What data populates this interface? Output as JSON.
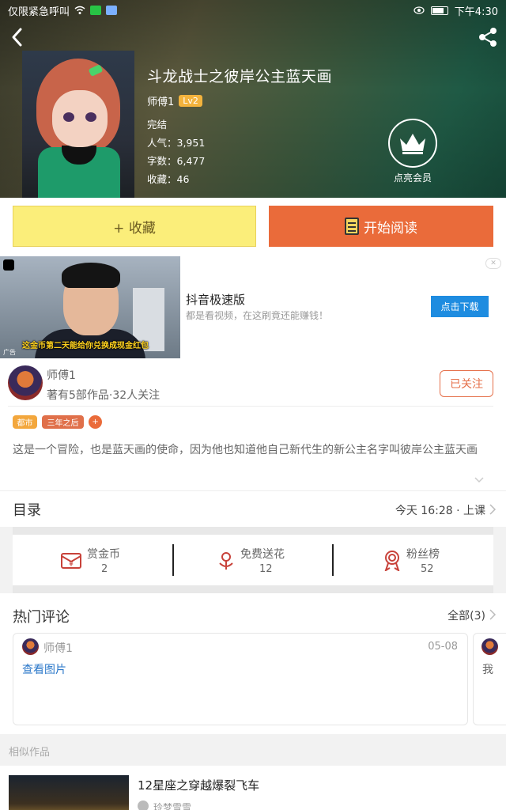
{
  "status_bar": {
    "left_text": "仅限紧急呼叫",
    "time": "下午4:30"
  },
  "book": {
    "title": "斗龙战士之彼岸公主蓝天画",
    "author": "师傅1",
    "level": "Lv2",
    "status": "完结",
    "popularity": "人气：3,951",
    "word_count": "字数：6,477",
    "favorites": "收藏：46"
  },
  "member": {
    "label": "点亮会员"
  },
  "actions": {
    "favorite_label": "+ 收藏",
    "read_label": "开始阅读"
  },
  "ad": {
    "video_caption": "这金币第二天能给你兑换成现金红包",
    "ad_tag": "广告",
    "title": "抖音极速版",
    "description": "都是看视频，在这刷竟还能赚钱！",
    "button": "点击下载"
  },
  "author_card": {
    "name": "师傅1",
    "summary": "著有5部作品·32人关注",
    "follow_label": "已关注",
    "tags": [
      "都市",
      "三年之后"
    ],
    "add_tag": "+",
    "description": "这是一个冒险，也是蓝天画的使命，因为他也知道他自己新代生的新公主名字叫彼岸公主蓝天画"
  },
  "catalog": {
    "heading": "目录",
    "latest": "今天 16:28 · 上课"
  },
  "stats": [
    {
      "label": "赏金币",
      "value": "2",
      "icon": "coin-envelope-icon"
    },
    {
      "label": "免费送花",
      "value": "12",
      "icon": "flower-icon"
    },
    {
      "label": "粉丝榜",
      "value": "52",
      "icon": "rosette-icon"
    }
  ],
  "comments": {
    "heading": "热门评论",
    "all_label": "全部(3)",
    "first": {
      "user": "师傅1",
      "date": "05-08",
      "link": "查看图片"
    },
    "second_snippet": "我"
  },
  "similar": {
    "heading": "相似作品",
    "first_title": "12星座之穿越爆裂飞车",
    "first_author": "玲梦雪雪"
  },
  "colors": {
    "accent_orange": "#ea6b3a",
    "favorite_yellow": "#fbee7a",
    "level_badge": "#f3b33d",
    "ad_button_blue": "#1e8ce0",
    "link_blue": "#2a77c9"
  }
}
